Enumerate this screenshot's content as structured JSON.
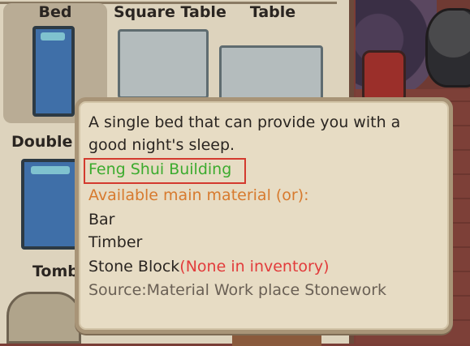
{
  "inventory": {
    "items": [
      {
        "label": "Bed"
      },
      {
        "label": "Square Table"
      },
      {
        "label": "Table"
      },
      {
        "label": "Double B"
      },
      {
        "label": "Tomb"
      }
    ]
  },
  "tooltip": {
    "description": "A single bed that can provide you with a good night's sleep.",
    "category": "Feng Shui Building",
    "materials_header": "Available main material (or):",
    "materials": [
      "Bar",
      "Timber",
      "Stone Block"
    ],
    "missing_note": "(None in inventory)",
    "source": "Source:Material Work place Stonework"
  },
  "colors": {
    "category": "#3cab2e",
    "materials_header": "#d77a2e",
    "warning": "#e23b3b",
    "highlight_box": "#d33a2e"
  }
}
